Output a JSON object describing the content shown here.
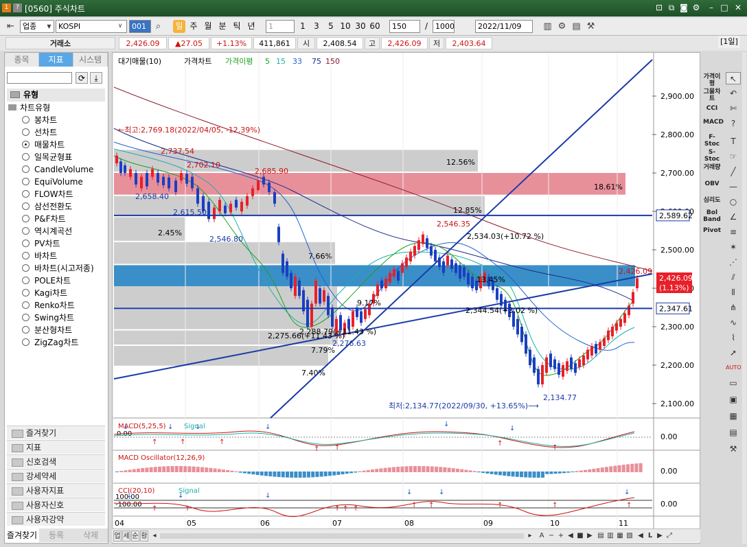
{
  "window": {
    "number": "1",
    "help": "?",
    "title": "[0560] 주식차트"
  },
  "toolbar": {
    "market": "업종",
    "symbol": "KOSPI",
    "periods": [
      "일",
      "주",
      "월",
      "분",
      "틱",
      "년"
    ],
    "interval": "1",
    "quick": [
      "1",
      "3",
      "5",
      "10",
      "30",
      "60"
    ],
    "count": "150",
    "count_sep": "/",
    "total": "1000",
    "date": "2022/11/09"
  },
  "quote": {
    "exchange": "거래소",
    "price": "2,426.09",
    "change": "▲27.05",
    "pct": "+1.13%",
    "volume": "411,861",
    "open_label": "시",
    "open": "2,408.54",
    "high_label": "고",
    "high": "2,426.09",
    "low_label": "저",
    "low": "2,403.64",
    "day": "[1일]"
  },
  "left": {
    "tabs": [
      "종목",
      "지표",
      "시스템"
    ],
    "section": "유형",
    "sub": "차트유형",
    "items": [
      {
        "label": "봉차트",
        "on": false
      },
      {
        "label": "선차트",
        "on": false
      },
      {
        "label": "매물차트",
        "on": true
      },
      {
        "label": "일목균형표",
        "on": false
      },
      {
        "label": "CandleVolume",
        "on": false
      },
      {
        "label": "EquiVolume",
        "on": false
      },
      {
        "label": "FLOW차트",
        "on": false
      },
      {
        "label": "삼선전환도",
        "on": false
      },
      {
        "label": "P&F차트",
        "on": false
      },
      {
        "label": "역시계곡선",
        "on": false
      },
      {
        "label": "PV차트",
        "on": false
      },
      {
        "label": "바차트",
        "on": false
      },
      {
        "label": "바차트(시고저종)",
        "on": false
      },
      {
        "label": "POLE차트",
        "on": false
      },
      {
        "label": "Kagi차트",
        "on": false
      },
      {
        "label": "Renko차트",
        "on": false
      },
      {
        "label": "Swing차트",
        "on": false
      },
      {
        "label": "분산형차트",
        "on": false
      },
      {
        "label": "ZigZag차트",
        "on": false
      }
    ],
    "groups": [
      "즐겨찾기",
      "지표",
      "신호검색",
      "강세약세",
      "사용자지표",
      "사용자신호",
      "사용자강약"
    ],
    "bottom": [
      "즐겨찾기",
      "등록",
      "삭제"
    ]
  },
  "chart": {
    "legend": {
      "vol": "대기매물(10)",
      "price": "가격차트",
      "ma_label": "가격이평",
      "ma": [
        "5",
        "15",
        "33",
        "75",
        "150"
      ],
      "ma_colors": [
        "#1aa31a",
        "#19b0a8",
        "#2060d0",
        "#1a2a8a",
        "#8b1a2a"
      ]
    },
    "y_ticks": [
      "2,900.00",
      "2,800.00",
      "2,700.00",
      "2,600.00",
      "2,500.00",
      "2,400.00",
      "2,300.00",
      "2,200.00",
      "2,100.00"
    ],
    "x_ticks": [
      "04",
      "05",
      "06",
      "07",
      "08",
      "09",
      "10",
      "11"
    ],
    "annotations": {
      "high_note": "←최고:2,769.18(2022/04/05, -12.39%)",
      "low_note": "최저:2,134.77(2022/09/30, +13.65%)⟶",
      "prices": [
        "2,737.54",
        "2,702.10",
        "2,685.90",
        "2,658.40",
        "2,615.50",
        "2,546.80",
        "2,546.35",
        "2,534.03(+10.72 %)",
        "2,426.09",
        "2,344.54(+3.02 %)",
        "2,275.66(+11.43 %)",
        "2,288.79(+11.43 %)",
        "2,276.63",
        "2,134.77",
        "9.17%",
        "13.45%"
      ],
      "vol_pct": [
        "12.56%",
        "18.61%",
        "12.85%",
        "2.45%",
        "7.66%",
        "7.79%",
        "7.40%"
      ]
    },
    "price_tags": {
      "h1": "2,589.62",
      "h2": "2,347.61",
      "last": "2,426.09",
      "last_pct": "(1.13%)"
    },
    "panels": {
      "macd": "MACD(5,25,5)",
      "macd_sig": "Signal",
      "macd_zero": "0.00",
      "osc": "MACD Oscillator(12,26,9)",
      "cci": "CCI(20,10)",
      "cci_sig": "Signal",
      "cci_hi": "100.00",
      "cci_lo": "-100.00",
      "axis0": "0.00"
    }
  },
  "right_bar": [
    "가격이평",
    "그물차트",
    "CCI",
    "MACD",
    "F-Stoc",
    "S-Stoc",
    "거래량",
    "OBV",
    "심리도",
    "Bol Band",
    "Pivot"
  ],
  "colors": {
    "title_bg": "#2f6b3a",
    "up": "#e8202a",
    "down": "#1a3fc0",
    "vol_hi": "#e8909a",
    "vol_cur": "#3a8fc8",
    "vol": "#cdcdcd",
    "tab_on": "#5aa7e6",
    "level": "#1a3aa8"
  }
}
